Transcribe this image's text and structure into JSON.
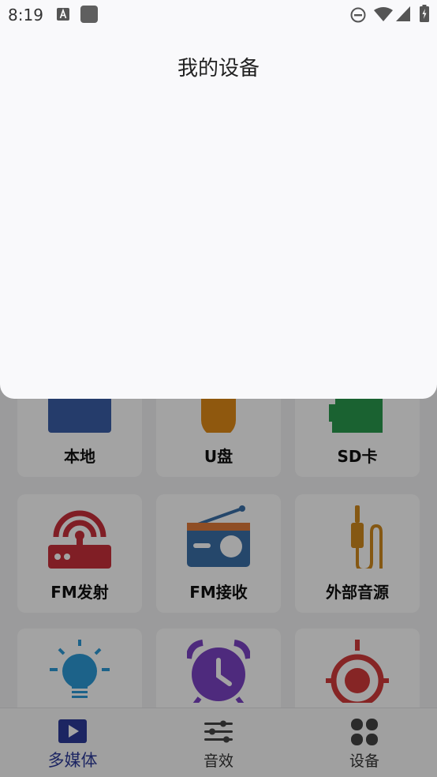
{
  "status_bar": {
    "time": "8:19",
    "left_icons": [
      "keyboard-a-icon",
      "app-square-icon"
    ],
    "right_icons": [
      "do-not-disturb-icon",
      "wifi-icon",
      "signal-icon",
      "battery-charging-icon"
    ]
  },
  "sheet": {
    "title": "我的设备"
  },
  "grid": {
    "tiles": [
      {
        "label": "本地",
        "icon": "local-storage-icon",
        "color": "#3b5fa8"
      },
      {
        "label": "U盘",
        "icon": "usb-drive-icon",
        "color": "#e08a17"
      },
      {
        "label": "SD卡",
        "icon": "sd-card-icon",
        "color": "#2a9a4e"
      },
      {
        "label": "FM发射",
        "icon": "fm-transmitter-icon",
        "color": "#c8303a"
      },
      {
        "label": "FM接收",
        "icon": "radio-icon",
        "color": "#3a6fa8"
      },
      {
        "label": "外部音源",
        "icon": "audio-jack-icon",
        "color": "#d08a1f"
      },
      {
        "label": "",
        "icon": "light-bulb-icon",
        "color": "#2d9ad6"
      },
      {
        "label": "",
        "icon": "alarm-clock-icon",
        "color": "#7a42c4"
      },
      {
        "label": "",
        "icon": "target-icon",
        "color": "#d23a3a"
      }
    ]
  },
  "bottom_nav": {
    "items": [
      {
        "label": "多媒体",
        "icon": "play-icon",
        "active": true
      },
      {
        "label": "音效",
        "icon": "equalizer-icon",
        "active": false
      },
      {
        "label": "设备",
        "icon": "devices-icon",
        "active": false
      }
    ],
    "active_color": "#2c3a9a"
  }
}
